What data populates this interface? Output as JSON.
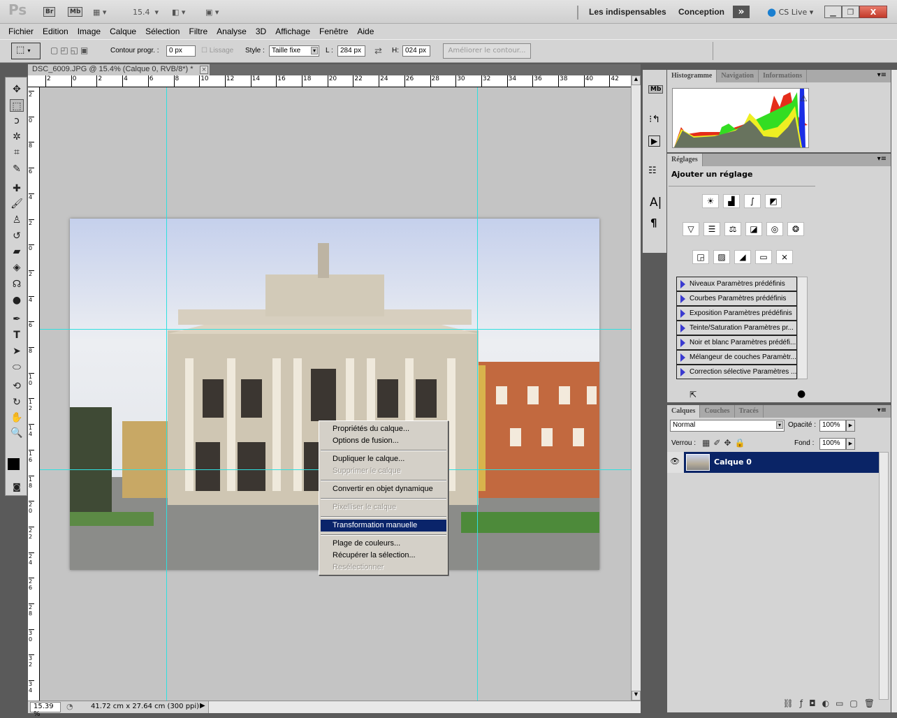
{
  "titlebar": {
    "app_logo": "Ps",
    "bridge": "Br",
    "mini_bridge": "Mb",
    "zoom": "15.4",
    "workspaces": [
      "Les indispensables",
      "Conception"
    ],
    "more": "»",
    "cs_live": "CS Live",
    "window_controls": [
      "minimize-icon",
      "restore-icon",
      "close-icon"
    ]
  },
  "menu": [
    "Fichier",
    "Edition",
    "Image",
    "Calque",
    "Sélection",
    "Filtre",
    "Analyse",
    "3D",
    "Affichage",
    "Fenêtre",
    "Aide"
  ],
  "options": {
    "feather_label": "Contour progr. :",
    "feather_value": "0 px",
    "antialias_label": "Lissage",
    "style_label": "Style :",
    "style_value": "Taille fixe",
    "width_label": "L :",
    "width_value": "284 px",
    "height_label": "H:",
    "height_value": "024 px",
    "refine_button": "Améliorer le contour..."
  },
  "document": {
    "tab_title": "DSC_6009.JPG @ 15.4% (Calque 0, RVB/8*) *",
    "ruler_top": [
      "2",
      "0",
      "2",
      "4",
      "6",
      "8",
      "10",
      "12",
      "14",
      "16",
      "18",
      "20",
      "22",
      "24",
      "26",
      "28",
      "30",
      "32",
      "34",
      "36",
      "38",
      "40",
      "42"
    ],
    "ruler_left": [
      "2",
      "0",
      "8",
      "6",
      "4",
      "2",
      "0",
      "2",
      "4",
      "6",
      "8",
      "1 0",
      "1 2",
      "1 4",
      "1 6",
      "1 8",
      "2 0",
      "2 2",
      "2 4",
      "2 6",
      "2 8",
      "3 0",
      "3 2",
      "3 4",
      "3 6"
    ]
  },
  "status": {
    "zoom": "15.39 %",
    "doc_size": "41.72 cm x 27.64 cm (300 ppi)"
  },
  "context_menu": {
    "items": [
      {
        "label": "Propriétés du calque...",
        "enabled": true
      },
      {
        "label": "Options de fusion...",
        "enabled": true
      },
      {
        "label": "Dupliquer le calque...",
        "enabled": true
      },
      {
        "label": "Supprimer le calque",
        "enabled": false
      },
      {
        "label": "Convertir en objet dynamique",
        "enabled": true
      },
      {
        "label": "Pixelliser le calque",
        "enabled": false
      },
      {
        "label": "Transformation manuelle",
        "enabled": true,
        "highlighted": true
      },
      {
        "label": "Plage de couleurs...",
        "enabled": true
      },
      {
        "label": "Récupérer la sélection...",
        "enabled": true
      },
      {
        "label": "Resélectionner",
        "enabled": false
      }
    ]
  },
  "panels": {
    "top_tabs": [
      "Histogramme",
      "Navigation",
      "Informations"
    ],
    "adjust_tab": "Réglages",
    "adjust_heading": "Ajouter un réglage",
    "presets": [
      "Niveaux Paramètres prédéfinis",
      "Courbes Paramètres prédéfinis",
      "Exposition Paramètres prédéfinis",
      "Teinte/Saturation Paramètres pr...",
      "Noir et blanc Paramètres prédéfi...",
      "Mélangeur de couches Paramètr...",
      "Correction sélective Paramètres ..."
    ],
    "layer_tabs": [
      "Calques",
      "Couches",
      "Tracés"
    ],
    "blend_mode": "Normal",
    "opacity_label": "Opacité :",
    "opacity": "100%",
    "lock_label": "Verrou :",
    "fill_label": "Fond :",
    "fill": "100%",
    "layers": [
      {
        "name": "Calque 0",
        "visible": true,
        "selected": true
      }
    ]
  },
  "colors": {
    "guide": "#2fe0e0",
    "selection": "#0a246a",
    "layer_selected": "#0a2466"
  }
}
